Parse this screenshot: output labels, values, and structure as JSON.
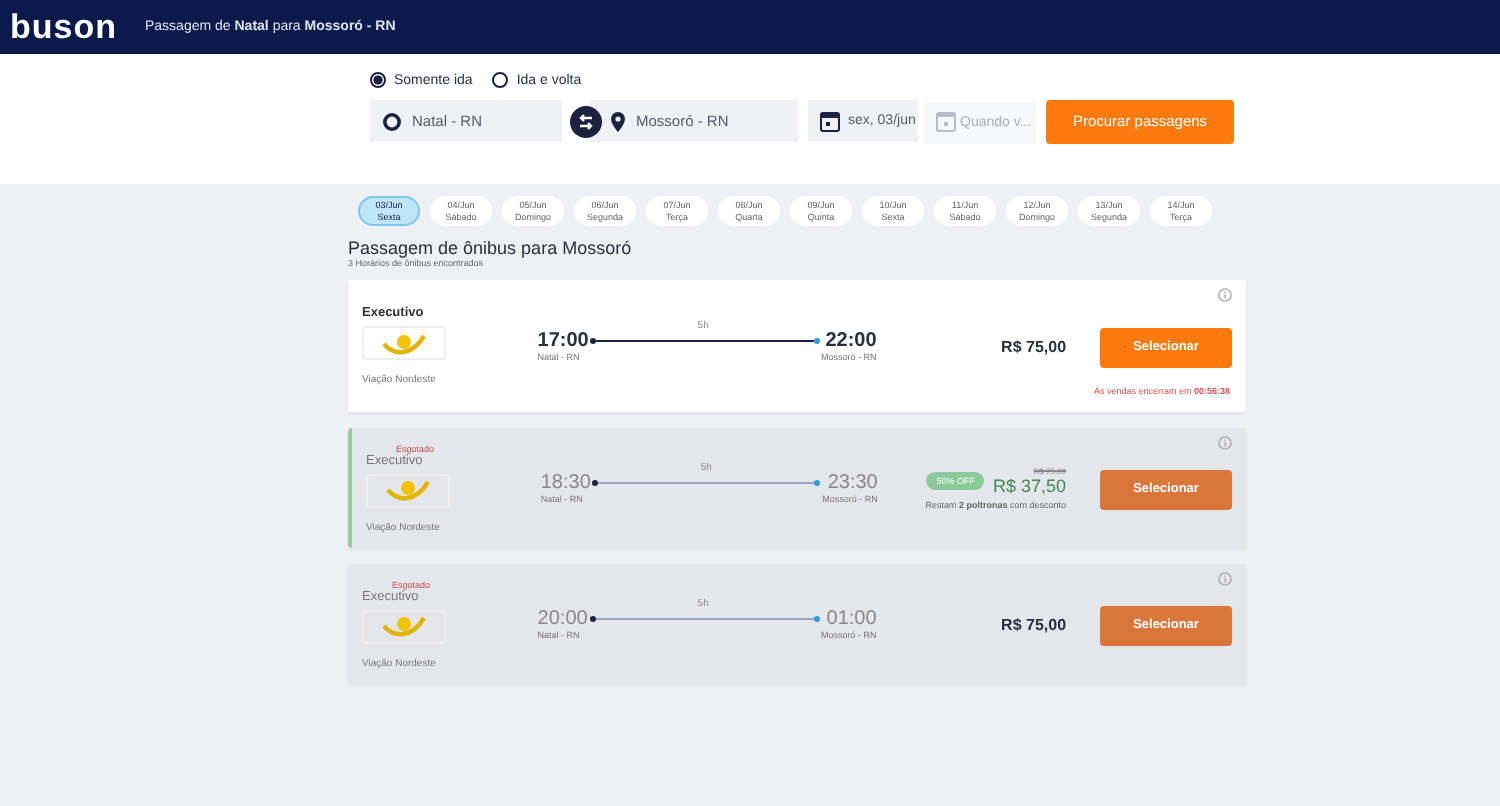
{
  "header": {
    "logo": "buson",
    "title": "Passagem de **Natal** para **Mossoró - RN**"
  },
  "search": {
    "trip_types": [
      {
        "label": "Somente ida",
        "selected": true
      },
      {
        "label": "Ida e volta",
        "selected": false
      }
    ],
    "origin": "Natal - RN",
    "destination": "Mossoró - RN",
    "date": "sex, 03/jun",
    "return_placeholder": "Quando v...",
    "button": "Procurar passagens"
  },
  "dates": [
    {
      "date": "03/Jun",
      "weekday": "Sexta",
      "selected": true
    },
    {
      "date": "04/Jun",
      "weekday": "Sábado",
      "selected": false
    },
    {
      "date": "05/Jun",
      "weekday": "Domingo",
      "selected": false
    },
    {
      "date": "06/Jun",
      "weekday": "Segunda",
      "selected": false
    },
    {
      "date": "07/Jun",
      "weekday": "Terça",
      "selected": false
    },
    {
      "date": "08/Jun",
      "weekday": "Quarta",
      "selected": false
    },
    {
      "date": "09/Jun",
      "weekday": "Quinta",
      "selected": false
    },
    {
      "date": "10/Jun",
      "weekday": "Sexta",
      "selected": false
    },
    {
      "date": "11/Jun",
      "weekday": "Sábado",
      "selected": false
    },
    {
      "date": "12/Jun",
      "weekday": "Domingo",
      "selected": false
    },
    {
      "date": "13/Jun",
      "weekday": "Segunda",
      "selected": false
    },
    {
      "date": "14/Jun",
      "weekday": "Terça",
      "selected": false
    }
  ],
  "results": {
    "title": "Passagem de ônibus para Mossoró",
    "count": "3 Horários de ônibus encontrados"
  },
  "trips": [
    {
      "disabled": false,
      "highlighted": false,
      "category": "Executivo",
      "company": "Viação Nordeste",
      "departure": "17:00",
      "departure_city": "Natal - RN",
      "duration": "5h",
      "arrival": "22:00",
      "arrival_city": "Mossoró - RN",
      "price": "R$ 75,00",
      "button": "Selecionar",
      "sales_note": "As vendas encerram em **00:56:38**"
    },
    {
      "disabled": true,
      "highlighted": true,
      "status": "Esgotado",
      "category": "Executivo",
      "company": "Viação Nordeste",
      "departure": "18:30",
      "departure_city": "Natal - RN",
      "duration": "5h",
      "arrival": "23:30",
      "arrival_city": "Mossoró - RN",
      "discount": "50% OFF",
      "old_price": "R$ 75,00",
      "price": "R$ 37,50",
      "seats_note": "Restam **2 poltronas** com desconto",
      "button": "Selecionar"
    },
    {
      "disabled": true,
      "highlighted": false,
      "status": "Esgotado",
      "category": "Executivo",
      "company": "Viação Nordeste",
      "departure": "20:00",
      "departure_city": "Natal - RN",
      "duration": "5h",
      "arrival": "01:00",
      "arrival_city": "Mossoró - RN",
      "price": "R$ 75,00",
      "button": "Selecionar"
    }
  ]
}
